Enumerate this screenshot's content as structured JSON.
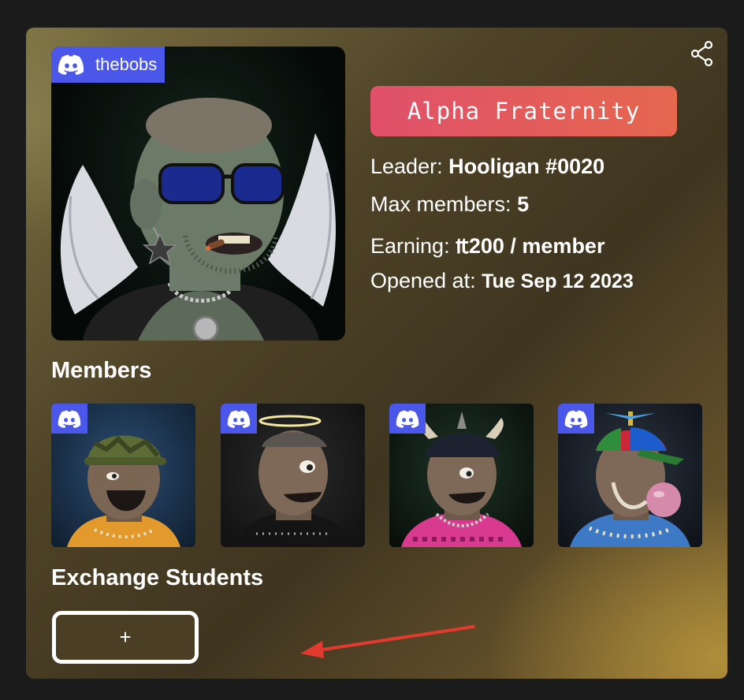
{
  "fraternity": {
    "name": "Alpha Fraternity",
    "discord_handle": "thebobs"
  },
  "info": {
    "leader_label": "Leader:",
    "leader_value": "Hooligan #0020",
    "max_label": "Max members:",
    "max_value": "5",
    "earning_label": "Earning:",
    "earning_value": "₶200 / member",
    "opened_label": "Opened at:",
    "opened_value": "Tue Sep 12 2023"
  },
  "sections": {
    "members_title": "Members",
    "exchange_title": "Exchange Students",
    "add_label": "+"
  },
  "members": [
    {
      "bg": "#1c3552",
      "shirt": "#e19a2b",
      "hat": "camo-helmet"
    },
    {
      "bg": "#1a1a1a",
      "shirt": "#151515",
      "hat": "halo"
    },
    {
      "bg": "#0f1a12",
      "shirt": "#d83a8f",
      "hat": "viking-helmet"
    },
    {
      "bg": "#1d2630",
      "shirt": "#3d79c4",
      "hat": "propeller-cap"
    }
  ],
  "colors": {
    "discord": "#4a57e8",
    "pill_start": "#e0506a",
    "pill_end": "#e5674e",
    "annotation_arrow": "#e23a2e"
  },
  "icons": {
    "share": "share-icon",
    "discord": "discord-icon"
  }
}
